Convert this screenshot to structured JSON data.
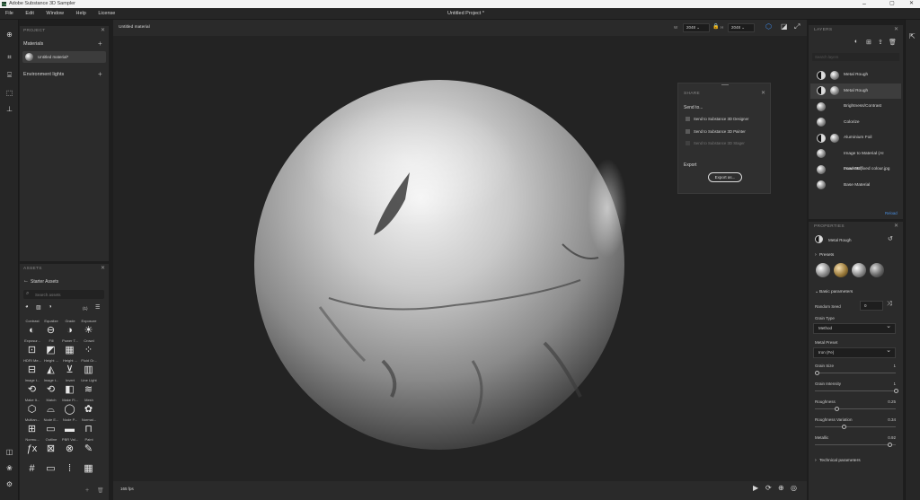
{
  "app": {
    "title": "Adobe Substance 3D Sampler",
    "project": "Untitled Project *"
  },
  "menu": [
    "File",
    "Edit",
    "Window",
    "Help",
    "License"
  ],
  "project_panel": {
    "title": "PROJECT",
    "materials_label": "Materials",
    "material_item": "Untitled material*",
    "env_label": "Environment lights"
  },
  "assets_panel": {
    "title": "ASSETS",
    "back_label": "Starter Assets",
    "search_placeholder": "Search assets",
    "filter_count": "(1)",
    "items": [
      {
        "label": "Contrast",
        "icon": "contrast-icon",
        "glyph": "◐"
      },
      {
        "label": "Equalize",
        "icon": "equalize-icon",
        "glyph": "⊖"
      },
      {
        "label": "Grade",
        "icon": "grade-icon",
        "glyph": "◑"
      },
      {
        "label": "Exposure",
        "icon": "exposure-icon",
        "glyph": "☀"
      },
      {
        "label": "Exposur...",
        "icon": "exposure-icon",
        "glyph": "⊡"
      },
      {
        "label": "Fill",
        "icon": "fill-icon",
        "glyph": "◩"
      },
      {
        "label": "Power T...",
        "icon": "power-icon",
        "glyph": "▦"
      },
      {
        "label": "Crowd",
        "icon": "crowd-icon",
        "glyph": "⁘"
      },
      {
        "label": "HDRI Me...",
        "icon": "hdri-icon",
        "glyph": "⊟"
      },
      {
        "label": "Height ...",
        "icon": "height-icon",
        "glyph": "◭"
      },
      {
        "label": "Height ...",
        "icon": "height-icon",
        "glyph": "⊻"
      },
      {
        "label": "Fluid Gr...",
        "icon": "fluid-icon",
        "glyph": "▥"
      },
      {
        "label": "Image t...",
        "icon": "image-icon",
        "glyph": "⟲"
      },
      {
        "label": "Image t...",
        "icon": "image-icon",
        "glyph": "⟲"
      },
      {
        "label": "Invert",
        "icon": "invert-icon",
        "glyph": "◧"
      },
      {
        "label": "Line Light",
        "icon": "line-light-icon",
        "glyph": "≋"
      },
      {
        "label": "Make It...",
        "icon": "make-icon",
        "glyph": "⬡"
      },
      {
        "label": "Match",
        "icon": "match-icon",
        "glyph": "⌓"
      },
      {
        "label": "Make Fl...",
        "icon": "make-flat-icon",
        "glyph": "◯"
      },
      {
        "label": "Mesh",
        "icon": "mesh-icon",
        "glyph": "✿"
      },
      {
        "label": "Multian...",
        "icon": "multiangle-icon",
        "glyph": "⊞"
      },
      {
        "label": "Node E...",
        "icon": "node-icon",
        "glyph": "▭"
      },
      {
        "label": "Node P...",
        "icon": "node-icon",
        "glyph": "▬"
      },
      {
        "label": "Normal...",
        "icon": "normal-icon",
        "glyph": "⊓"
      },
      {
        "label": "Normu...",
        "icon": "fx-icon",
        "glyph": "ƒx"
      },
      {
        "label": "Outline",
        "icon": "outline-icon",
        "glyph": "⊠"
      },
      {
        "label": "PBR Val...",
        "icon": "pbr-icon",
        "glyph": "⊗"
      },
      {
        "label": "Paint",
        "icon": "paint-icon",
        "glyph": "✎"
      },
      {
        "label": "",
        "icon": "grid-icon",
        "glyph": "#"
      },
      {
        "label": "",
        "icon": "landscape-icon",
        "glyph": "▭"
      },
      {
        "label": "",
        "icon": "dots-icon",
        "glyph": "⁞"
      },
      {
        "label": "",
        "icon": "pattern-icon",
        "glyph": "▦"
      }
    ]
  },
  "viewport": {
    "material_name": "Untitled material",
    "width_label": "W",
    "width_value": "2048",
    "height_label": "H",
    "height_value": "2048",
    "fps": "165 fps"
  },
  "share": {
    "title": "SHARE",
    "send_to": "Send to...",
    "items": [
      "Send to Substance 3D Designer",
      "Send to Substance 3D Painter",
      "Send to Substance 3D Stager"
    ],
    "export_label": "Export",
    "export_button": "Export as..."
  },
  "layers": {
    "title": "LAYERS",
    "search_placeholder": "Search layers",
    "items": [
      "Metal Rough",
      "Metal Rough",
      "Brightness/Contrast",
      "Colorize",
      "Aluminium Foil",
      "Image to Material (AI Powered)",
      "Load 3D fixed colour.jpg",
      "Base Material"
    ],
    "reload": "Reload"
  },
  "properties": {
    "title": "PROPERTIES",
    "layer_name": "Metal Rough",
    "presets_label": "Presets",
    "basic_label": "Basic parameters",
    "random_seed_label": "Random Seed",
    "random_seed_value": "0",
    "grain_type_label": "Grain Type",
    "grain_type_value": "Method",
    "metal_preset_label": "Metal Preset",
    "metal_preset_value": "Iron (Fe)",
    "grain_size_label": "Grain Size",
    "grain_size_value": "1",
    "grain_size_level": 0.0,
    "grain_intensity_label": "Grain Intensity",
    "grain_intensity_value": "1",
    "grain_intensity_level": 1.0,
    "roughness_label": "Roughness",
    "roughness_value": "0.25",
    "roughness_level": 0.25,
    "roughness_var_label": "Roughness Variation",
    "roughness_var_value": "0.34",
    "roughness_var_level": 0.34,
    "metallic_label": "Metallic",
    "metallic_value": "0.92",
    "metallic_level": 0.92,
    "technical_label": "Technical parameters"
  }
}
